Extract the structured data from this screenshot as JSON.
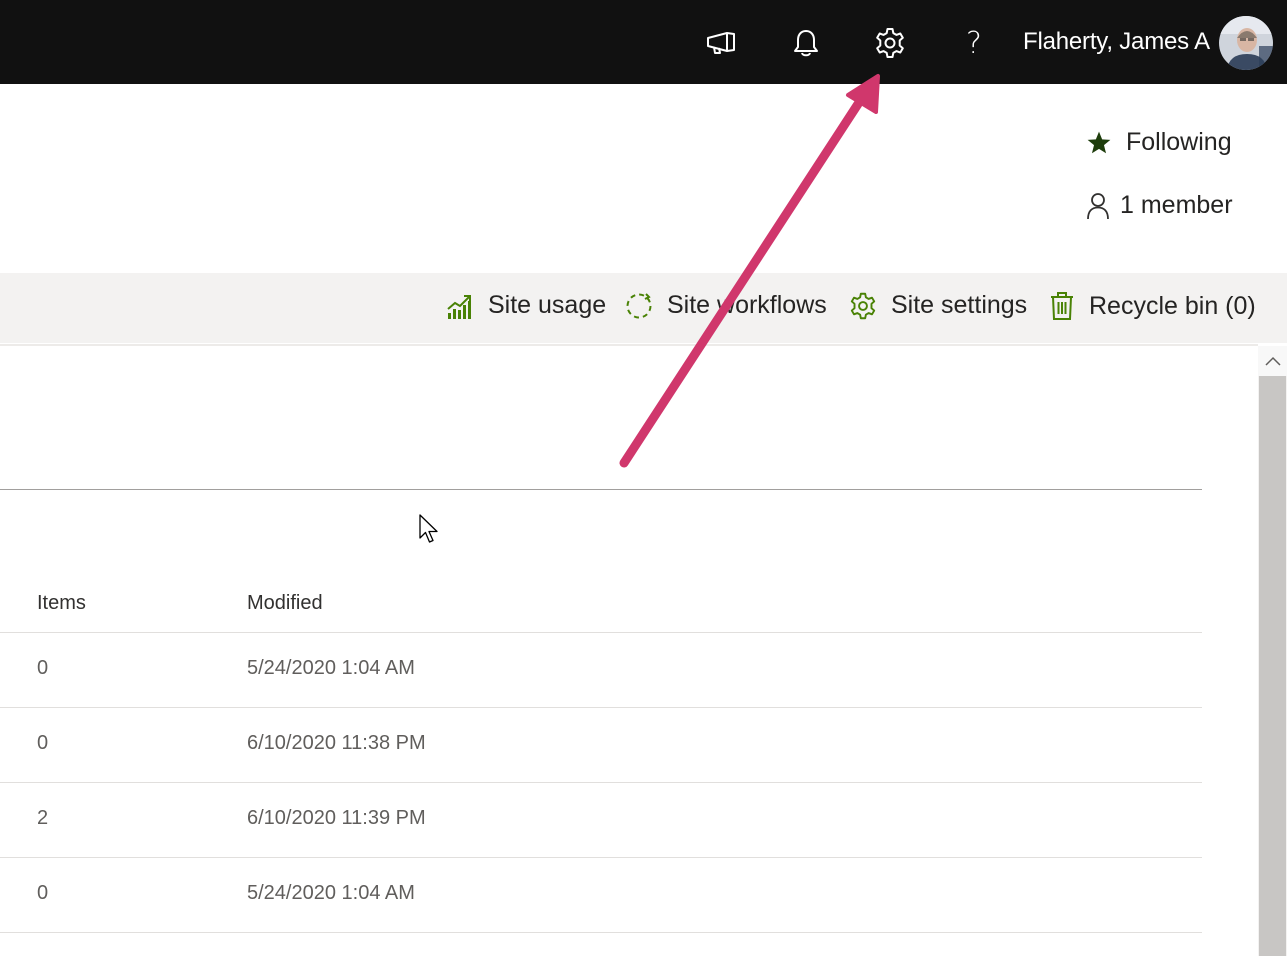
{
  "topbar": {
    "icons": [
      "megaphone-icon",
      "bell-icon",
      "gear-icon",
      "help-icon"
    ],
    "help_glyph": "?",
    "user_name": "Flaherty, James A"
  },
  "header": {
    "following_label": "Following",
    "members_label": "1 member"
  },
  "command_bar": {
    "items": [
      {
        "label": "Site usage",
        "icon": "site-usage-icon"
      },
      {
        "label": "Site workflows",
        "icon": "site-workflows-icon"
      },
      {
        "label": "Site settings",
        "icon": "site-settings-icon"
      },
      {
        "label": "Recycle bin (0)",
        "icon": "recycle-bin-icon"
      }
    ]
  },
  "table": {
    "columns": [
      "Items",
      "Modified"
    ],
    "rows": [
      {
        "items": "0",
        "modified": "5/24/2020 1:04 AM"
      },
      {
        "items": "0",
        "modified": "6/10/2020 11:38 PM"
      },
      {
        "items": "2",
        "modified": "6/10/2020 11:39 PM"
      },
      {
        "items": "0",
        "modified": "5/24/2020 1:04 AM"
      }
    ]
  },
  "colors": {
    "topbar_bg": "#111111",
    "command_bar_bg": "#f3f2f1",
    "accent_green": "#498205",
    "star_color": "#1e3d0c",
    "annotation_arrow": "#d0376c"
  }
}
